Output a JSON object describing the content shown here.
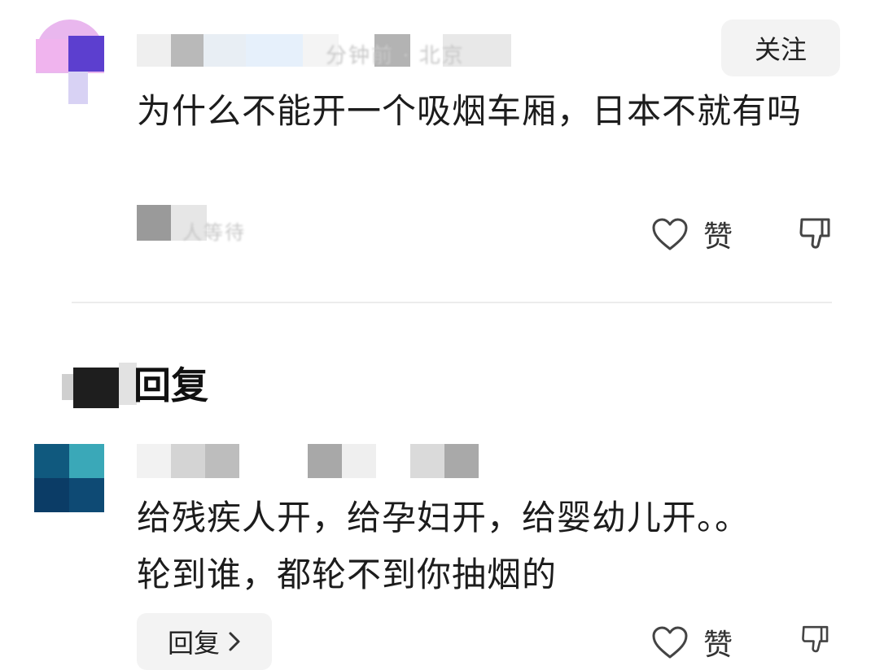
{
  "comment": {
    "meta_fragment": "分钟前 · 北京",
    "follow_label": "关注",
    "text": "为什么不能开一个吸烟车厢，日本不就有吗",
    "sub_meta_fragment": "人等待",
    "like_label": "赞",
    "icons": [
      "heart-icon",
      "thumbs-down-icon"
    ]
  },
  "reply_section": {
    "title": "回复"
  },
  "reply": {
    "text_line1": "给残疾人开，给孕妇开，给婴幼儿开。。",
    "text_line2": "轮到谁，都轮不到你抽烟的",
    "reply_button_label": "回复",
    "like_label": "赞",
    "icons": [
      "heart-icon",
      "thumbs-down-icon",
      "chevron-right-icon"
    ]
  },
  "colors": {
    "accent_bg": "#f3f3f3",
    "text": "#1c1c1c",
    "divider": "#ececec"
  }
}
